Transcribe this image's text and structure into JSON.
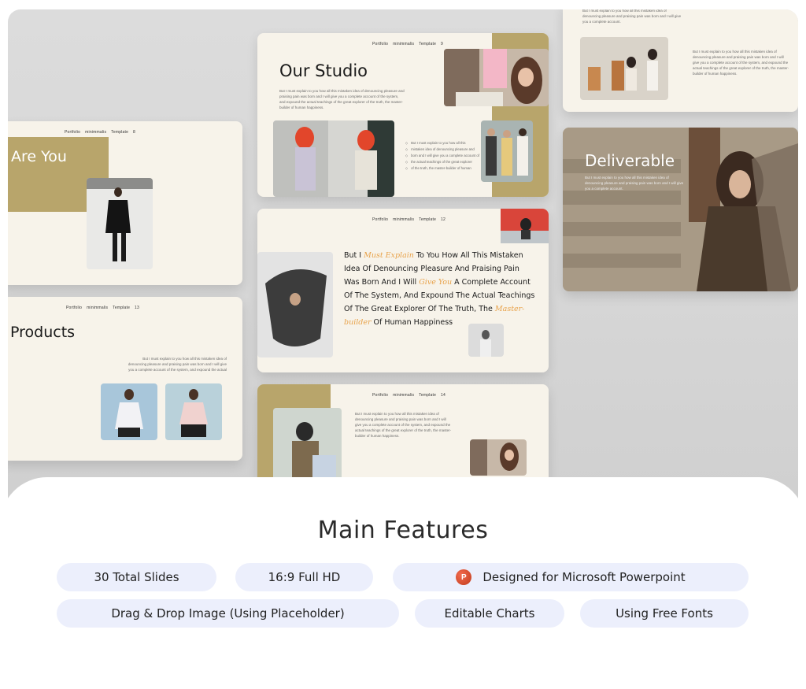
{
  "slides": {
    "nav_items": [
      "Portfolio",
      "minimmalis",
      "Template"
    ],
    "studio": {
      "title": "Our Studio",
      "page": "9",
      "body": "But I must explain to you how all this mistaken idea of denouncing pleasure and praising pain was born and I will give you a complete account of the system, and expound the actual teachings of the great explorer of the truth, the master-builder of human happiness."
    },
    "who": {
      "title": "Are You",
      "page": "8"
    },
    "products": {
      "title": "Products",
      "page": "13",
      "body": "But I must explain to you how all this mistaken idea of denouncing pleasure and praising pain was born and I will give you a complete account of the system, and expound the actual"
    },
    "quote": {
      "page": "12",
      "parts": [
        "But I ",
        "Must Explain",
        " To You How All This Mistaken Idea Of Denouncing Pleasure And Praising Pain Was Born And I Will ",
        "Give You",
        " A Complete Account Of The System, And Expound The Actual Teachings Of The Great Explorer Of The Truth, The ",
        "Master-builder",
        " Of Human Happiness"
      ]
    },
    "deliverable": {
      "title": "Deliverable",
      "body": "But I must explain to you how all this mistaken idea of denouncing pleasure and praising pain was born and I will give you a complete account."
    },
    "bottom": {
      "page": "14"
    },
    "bullets": [
      "But I must explain to you how all this",
      "mistaken idea of denouncing pleasure and",
      "born and I will give you a complete account of",
      "the actual teachings of the great explorer",
      "of the truth, the master-builder of human"
    ]
  },
  "features": {
    "title": "Main Features",
    "items": [
      {
        "label": "30 Total Slides"
      },
      {
        "label": "16:9 Full HD"
      },
      {
        "label": "Designed for Microsoft Powerpoint",
        "icon": "powerpoint-icon"
      },
      {
        "label": "Drag & Drop Image (Using Placeholder)"
      },
      {
        "label": "Editable Charts"
      },
      {
        "label": "Using Free Fonts"
      }
    ]
  },
  "colors": {
    "gold": "#b8a56b",
    "cream": "#f7f3ea",
    "pill": "#eceffc",
    "accent": "#e8a24a"
  }
}
